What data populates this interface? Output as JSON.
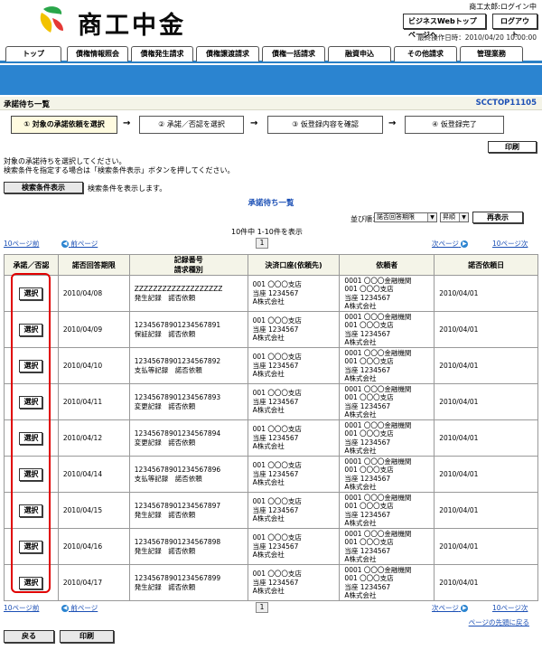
{
  "header": {
    "logo_text": "商工中金",
    "user_name": "商工太郎:ログイン中",
    "top_page_button": "ビジネスWebトップページへ",
    "logout_button": "ログアウト",
    "last_operation": "最終操作日時：2010/04/20 10:00:00"
  },
  "tabs": [
    "トップ",
    "債権情報照会",
    "債権発生請求",
    "債権譲渡請求",
    "債権一括請求",
    "融資申込",
    "その他請求",
    "管理業務"
  ],
  "title_bar": {
    "title": "承諾待ち一覧",
    "screen_id": "SCCTOP11105"
  },
  "steps": [
    "① 対象の承諾依頼を選択",
    "② 承諾／否認を選択",
    "③ 仮登録内容を確認",
    "④ 仮登録完了"
  ],
  "arrow": "→",
  "print_label": "印刷",
  "instructions": [
    "対象の承諾待ちを選択してください。",
    "検索条件を指定する場合は「検索条件表示」ボタンを押してください。"
  ],
  "search": {
    "button": "検索条件表示",
    "hint": "検索条件を表示します。"
  },
  "list_title": "承諾待ち一覧",
  "sort": {
    "label": "並び順：",
    "field": "諾否回答期限",
    "order": "昇順",
    "redisplay": "再表示"
  },
  "result_count": "10件中 1-10件を表示",
  "pager": {
    "prev10": "10ページ前",
    "prev": "前ページ",
    "page": "1",
    "next": "次ページ",
    "next10": "10ページ次",
    "prev_icon": "◀",
    "next_icon": "▶"
  },
  "table": {
    "headers": {
      "accept": "承諾／否認",
      "deadline": "諾否回答期限",
      "record_no_1": "記録番号",
      "record_no_2": "請求種別",
      "account": "決済口座(依頼先)",
      "requester": "依頼者",
      "request_date": "諾否依頼日"
    },
    "select_label": "選択",
    "rows": [
      {
        "deadline": "2010/04/08",
        "record": "ZZZZZZZZZZZZZZZZZZZ",
        "kind": "発生記録　諾否依頼",
        "acc1": "001 〇〇〇支店",
        "acc2": "当座 1234567",
        "acc3": "A株式会社",
        "req1": "0001 〇〇〇金融機関",
        "req2": "001 〇〇〇支店",
        "req3": "当座 1234567",
        "req4": "A株式会社",
        "date": "2010/04/01"
      },
      {
        "deadline": "2010/04/09",
        "record": "12345678901234567891",
        "kind": "保証記録　諾否依頼",
        "acc1": "001 〇〇〇支店",
        "acc2": "当座 1234567",
        "acc3": "A株式会社",
        "req1": "0001 〇〇〇金融機関",
        "req2": "001 〇〇〇支店",
        "req3": "当座 1234567",
        "req4": "A株式会社",
        "date": "2010/04/01"
      },
      {
        "deadline": "2010/04/10",
        "record": "12345678901234567892",
        "kind": "支払等記録　諾否依頼",
        "acc1": "001 〇〇〇支店",
        "acc2": "当座 1234567",
        "acc3": "A株式会社",
        "req1": "0001 〇〇〇金融機関",
        "req2": "001 〇〇〇支店",
        "req3": "当座 1234567",
        "req4": "A株式会社",
        "date": "2010/04/01"
      },
      {
        "deadline": "2010/04/11",
        "record": "12345678901234567893",
        "kind": "変更記録　諾否依頼",
        "acc1": "001 〇〇〇支店",
        "acc2": "当座 1234567",
        "acc3": "A株式会社",
        "req1": "0001 〇〇〇金融機関",
        "req2": "001 〇〇〇支店",
        "req3": "当座 1234567",
        "req4": "A株式会社",
        "date": "2010/04/01"
      },
      {
        "deadline": "2010/04/12",
        "record": "12345678901234567894",
        "kind": "変更記録　諾否依頼",
        "acc1": "001 〇〇〇支店",
        "acc2": "当座 1234567",
        "acc3": "A株式会社",
        "req1": "0001 〇〇〇金融機関",
        "req2": "001 〇〇〇支店",
        "req3": "当座 1234567",
        "req4": "A株式会社",
        "date": "2010/04/01"
      },
      {
        "deadline": "2010/04/14",
        "record": "12345678901234567896",
        "kind": "支払等記録　諾否依頼",
        "acc1": "001 〇〇〇支店",
        "acc2": "当座 1234567",
        "acc3": "A株式会社",
        "req1": "0001 〇〇〇金融機関",
        "req2": "001 〇〇〇支店",
        "req3": "当座 1234567",
        "req4": "A株式会社",
        "date": "2010/04/01"
      },
      {
        "deadline": "2010/04/15",
        "record": "12345678901234567897",
        "kind": "発生記録　諾否依頼",
        "acc1": "001 〇〇〇支店",
        "acc2": "当座 1234567",
        "acc3": "A株式会社",
        "req1": "0001 〇〇〇金融機関",
        "req2": "001 〇〇〇支店",
        "req3": "当座 1234567",
        "req4": "A株式会社",
        "date": "2010/04/01"
      },
      {
        "deadline": "2010/04/16",
        "record": "12345678901234567898",
        "kind": "発生記録　諾否依頼",
        "acc1": "001 〇〇〇支店",
        "acc2": "当座 1234567",
        "acc3": "A株式会社",
        "req1": "0001 〇〇〇金融機関",
        "req2": "001 〇〇〇支店",
        "req3": "当座 1234567",
        "req4": "A株式会社",
        "date": "2010/04/01"
      },
      {
        "deadline": "2010/04/17",
        "record": "12345678901234567899",
        "kind": "発生記録　諾否依頼",
        "acc1": "001 〇〇〇支店",
        "acc2": "当座 1234567",
        "acc3": "A株式会社",
        "req1": "0001 〇〇〇金融機関",
        "req2": "001 〇〇〇支店",
        "req3": "当座 1234567",
        "req4": "A株式会社",
        "date": "2010/04/01"
      }
    ]
  },
  "page_top_link": "ページの先頭に戻る",
  "footer": {
    "back": "戻る",
    "print": "印刷"
  },
  "colors": {
    "band": "#2b84d0",
    "link": "#1b4fb5",
    "highlight_box": "#e00000"
  }
}
